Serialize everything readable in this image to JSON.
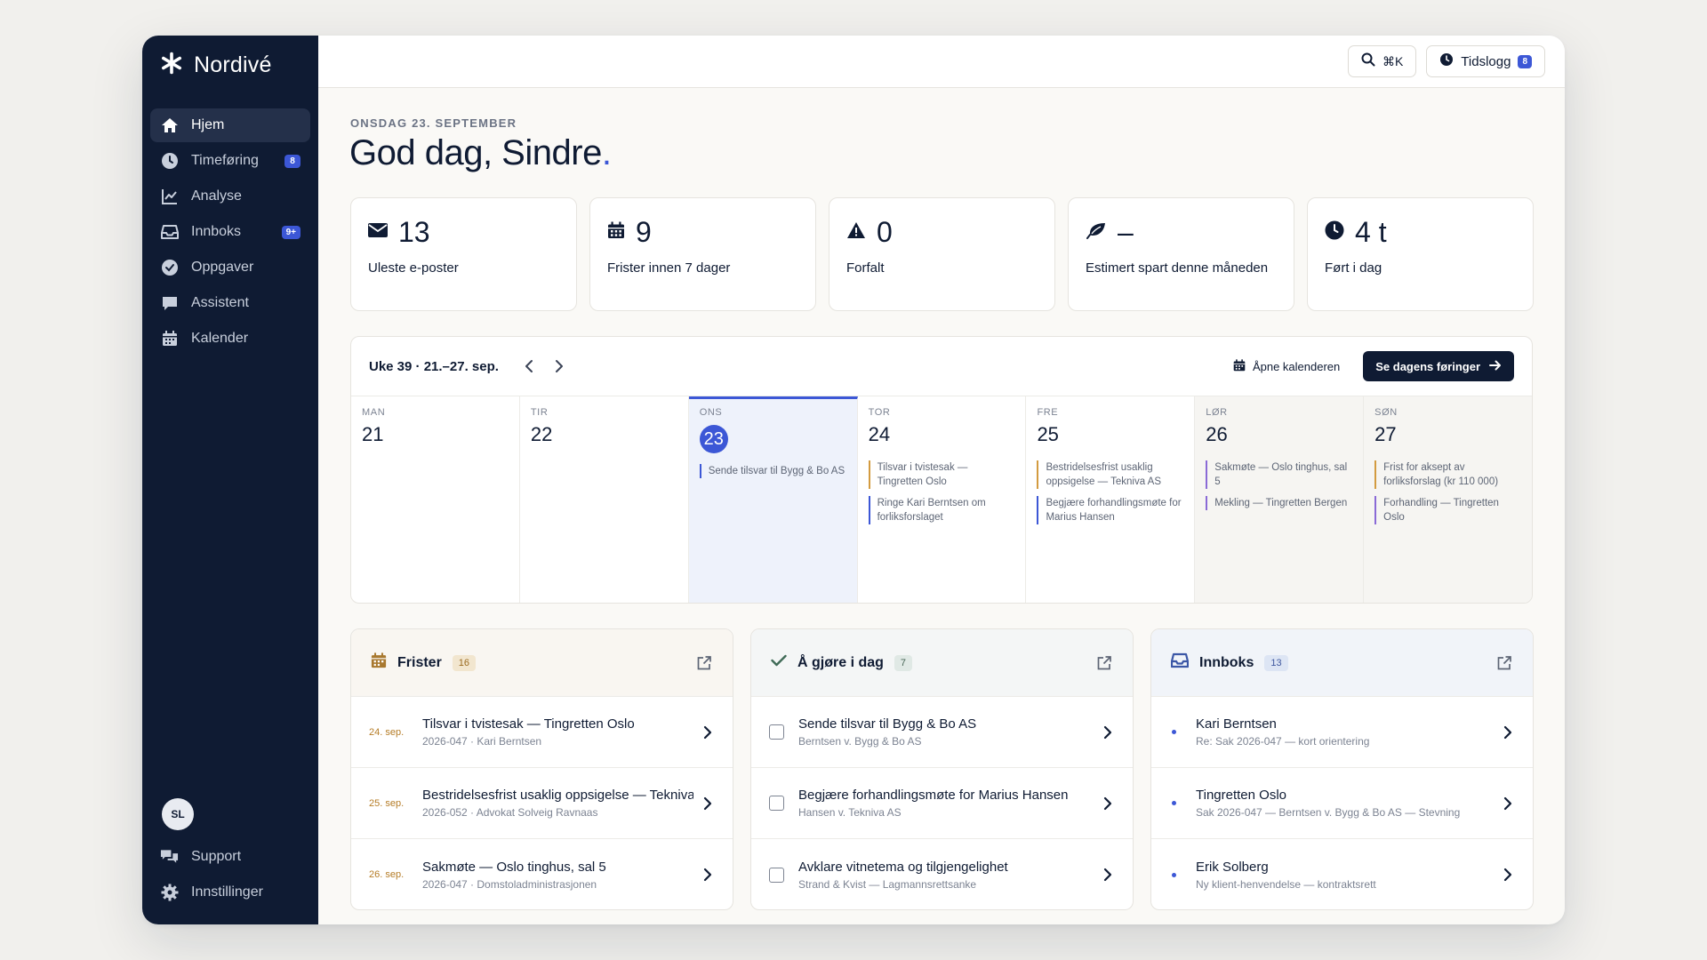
{
  "brand": {
    "name": "Nordivé"
  },
  "sidebar": {
    "items": [
      {
        "label": "Hjem",
        "icon": "home-icon",
        "active": true,
        "badge": ""
      },
      {
        "label": "Timeføring",
        "icon": "clock-icon",
        "badge": "8"
      },
      {
        "label": "Analyse",
        "icon": "chart-icon",
        "badge": ""
      },
      {
        "label": "Innboks",
        "icon": "inbox-icon",
        "badge": "9+"
      },
      {
        "label": "Oppgaver",
        "icon": "check-circle-icon",
        "badge": ""
      },
      {
        "label": "Assistent",
        "icon": "chat-icon",
        "badge": ""
      },
      {
        "label": "Kalender",
        "icon": "calendar-icon",
        "badge": ""
      }
    ],
    "avatar_initials": "SL",
    "bottom": [
      {
        "label": "Support",
        "icon": "support-icon"
      },
      {
        "label": "Innstillinger",
        "icon": "gear-icon"
      }
    ]
  },
  "topbar": {
    "search_shortcut": "⌘K",
    "timelog_label": "Tidslogg",
    "timelog_badge": "8"
  },
  "header": {
    "date": "ONSDAG 23. SEPTEMBER",
    "greeting": "God dag, Sindre",
    "greeting_dot": "."
  },
  "stats": [
    {
      "value": "13",
      "label": "Uleste e-poster",
      "icon": "mail-icon"
    },
    {
      "value": "9",
      "label": "Frister innen 7 dager",
      "icon": "calendar-icon"
    },
    {
      "value": "0",
      "label": "Forfalt",
      "icon": "warning-icon"
    },
    {
      "value": "–",
      "label": "Estimert spart denne måneden",
      "icon": "leaf-icon"
    },
    {
      "value": "4 t",
      "label": "Ført i dag",
      "icon": "clock-icon"
    }
  ],
  "calendar": {
    "title": "Uke 39 · 21.–27. sep.",
    "open_label": "Åpne kalenderen",
    "cta_label": "Se dagens føringer",
    "days": [
      {
        "abbr": "MAN",
        "num": "21",
        "events": []
      },
      {
        "abbr": "TIR",
        "num": "22",
        "events": []
      },
      {
        "abbr": "ONS",
        "num": "23",
        "today": true,
        "events": [
          {
            "text": "Sende tilsvar til Bygg & Bo AS",
            "color": "blue"
          }
        ]
      },
      {
        "abbr": "TOR",
        "num": "24",
        "events": [
          {
            "text": "Tilsvar i tvistesak — Tingretten Oslo",
            "color": "amber"
          },
          {
            "text": "Ringe Kari Berntsen om forliksforslaget",
            "color": "blue"
          }
        ]
      },
      {
        "abbr": "FRE",
        "num": "25",
        "events": [
          {
            "text": "Bestridelsesfrist usaklig oppsigelse — Tekniva AS",
            "color": "amber"
          },
          {
            "text": "Begjære forhandlingsmøte for Marius Hansen",
            "color": "blue"
          }
        ]
      },
      {
        "abbr": "LØR",
        "num": "26",
        "weekend": true,
        "events": [
          {
            "text": "Sakmøte — Oslo tinghus, sal 5",
            "color": "amber"
          },
          {
            "text": "Mekling — Tingretten Bergen",
            "color": "purple"
          }
        ]
      },
      {
        "abbr": "SØN",
        "num": "27",
        "weekend": true,
        "events": [
          {
            "text": "Frist for aksept av forliksforslag (kr 110 000)",
            "color": "amber"
          },
          {
            "text": "Forhandling — Tingretten Oslo",
            "color": "purple"
          }
        ]
      }
    ]
  },
  "panels": {
    "frister": {
      "title": "Frister",
      "count": "16",
      "rows": [
        {
          "lead": "24. sep.",
          "title": "Tilsvar i tvistesak — Tingretten Oslo",
          "sub": "2026-047 · Kari Berntsen"
        },
        {
          "lead": "25. sep.",
          "title": "Bestridelsesfrist usaklig oppsigelse — Tekniva AS",
          "sub": "2026-052 · Advokat Solveig Ravnaas"
        },
        {
          "lead": "26. sep.",
          "title": "Sakmøte — Oslo tinghus, sal 5",
          "sub": "2026-047 · Domstoladministrasjonen"
        }
      ]
    },
    "todo": {
      "title": "Å gjøre i dag",
      "count": "7",
      "rows": [
        {
          "title": "Sende tilsvar til Bygg & Bo AS",
          "sub": "Berntsen v. Bygg & Bo AS"
        },
        {
          "title": "Begjære forhandlingsmøte for Marius Hansen",
          "sub": "Hansen v. Tekniva AS"
        },
        {
          "title": "Avklare vitnetema og tilgjengelighet",
          "sub": "Strand & Kvist — Lagmannsrettsanke"
        }
      ]
    },
    "innboks": {
      "title": "Innboks",
      "count": "13",
      "rows": [
        {
          "title": "Kari Berntsen",
          "sub": "Re: Sak 2026-047 — kort orientering"
        },
        {
          "title": "Tingretten Oslo",
          "sub": "Sak 2026-047 — Berntsen v. Bygg & Bo AS — Stevning"
        },
        {
          "title": "Erik Solberg",
          "sub": "Ny klient-henvendelse — kontraktsrett"
        }
      ]
    }
  }
}
